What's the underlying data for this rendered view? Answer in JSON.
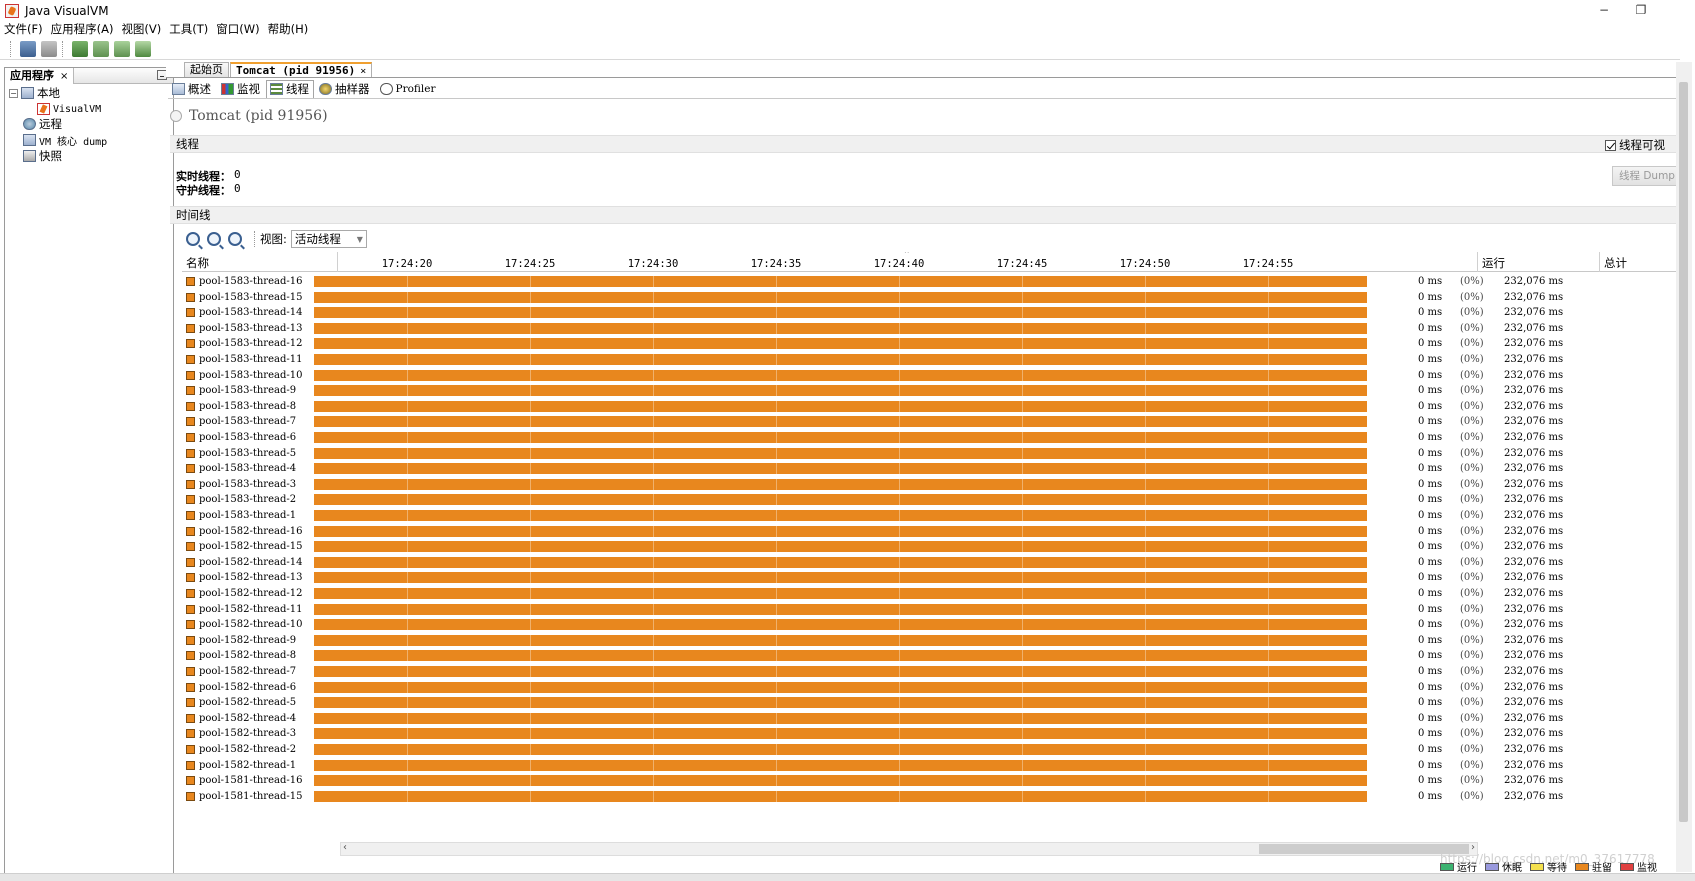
{
  "window": {
    "title": "Java VisualVM",
    "minimize_glyph": "−",
    "restore_glyph": "❐"
  },
  "menus": [
    "文件(F)",
    "应用程序(A)",
    "视图(V)",
    "工具(T)",
    "窗口(W)",
    "帮助(H)"
  ],
  "left_panel": {
    "tab_label": "应用程序",
    "close_glyph": "×",
    "tree": [
      {
        "label": "本地",
        "icon": "computer-icon",
        "expanded": true
      },
      {
        "label": "VisualVM",
        "icon": "visualvm-icon"
      },
      {
        "label": "远程",
        "icon": "remote-host-icon"
      },
      {
        "label": "VM 核心 dump",
        "icon": "core-dump-icon"
      },
      {
        "label": "快照",
        "icon": "snapshot-icon"
      }
    ]
  },
  "doc_tabs": [
    {
      "label": "起始页",
      "active": false
    },
    {
      "label": "Tomcat (pid 91956)",
      "active": true,
      "close_glyph": "×"
    }
  ],
  "sub_tabs": [
    {
      "label": "概述",
      "icon": "overview-icon"
    },
    {
      "label": "监视",
      "icon": "monitor-icon"
    },
    {
      "label": "线程",
      "icon": "threads-icon",
      "active": true
    },
    {
      "label": "抽样器",
      "icon": "sampler-icon"
    },
    {
      "label": "Profiler",
      "icon": "profiler-icon"
    }
  ],
  "process_title": "Tomcat (pid 91956)",
  "threads_section": {
    "header": "线程",
    "visible_checkbox_label": "线程可视",
    "visible_checked": true,
    "live_threads_label": "实时线程：",
    "live_threads_value": "0",
    "daemon_threads_label": "守护线程：",
    "daemon_threads_value": "0",
    "dump_button_label": "线程 Dump"
  },
  "timeline": {
    "header": "时间线",
    "view_label": "视图:",
    "view_selected": "活动线程",
    "columns": {
      "name": "名称",
      "running": "运行",
      "total": "总计"
    },
    "ticks": [
      "17:24:20",
      "17:24:25",
      "17:24:30",
      "17:24:35",
      "17:24:40",
      "17:24:45",
      "17:24:50",
      "17:24:55"
    ],
    "state_color": "#e8871e",
    "threads": [
      {
        "name": "pool-1583-thread-16",
        "running": "0 ms",
        "pct": "(0%)",
        "total": "232,076 ms"
      },
      {
        "name": "pool-1583-thread-15",
        "running": "0 ms",
        "pct": "(0%)",
        "total": "232,076 ms"
      },
      {
        "name": "pool-1583-thread-14",
        "running": "0 ms",
        "pct": "(0%)",
        "total": "232,076 ms"
      },
      {
        "name": "pool-1583-thread-13",
        "running": "0 ms",
        "pct": "(0%)",
        "total": "232,076 ms"
      },
      {
        "name": "pool-1583-thread-12",
        "running": "0 ms",
        "pct": "(0%)",
        "total": "232,076 ms"
      },
      {
        "name": "pool-1583-thread-11",
        "running": "0 ms",
        "pct": "(0%)",
        "total": "232,076 ms"
      },
      {
        "name": "pool-1583-thread-10",
        "running": "0 ms",
        "pct": "(0%)",
        "total": "232,076 ms"
      },
      {
        "name": "pool-1583-thread-9",
        "running": "0 ms",
        "pct": "(0%)",
        "total": "232,076 ms"
      },
      {
        "name": "pool-1583-thread-8",
        "running": "0 ms",
        "pct": "(0%)",
        "total": "232,076 ms"
      },
      {
        "name": "pool-1583-thread-7",
        "running": "0 ms",
        "pct": "(0%)",
        "total": "232,076 ms"
      },
      {
        "name": "pool-1583-thread-6",
        "running": "0 ms",
        "pct": "(0%)",
        "total": "232,076 ms"
      },
      {
        "name": "pool-1583-thread-5",
        "running": "0 ms",
        "pct": "(0%)",
        "total": "232,076 ms"
      },
      {
        "name": "pool-1583-thread-4",
        "running": "0 ms",
        "pct": "(0%)",
        "total": "232,076 ms"
      },
      {
        "name": "pool-1583-thread-3",
        "running": "0 ms",
        "pct": "(0%)",
        "total": "232,076 ms"
      },
      {
        "name": "pool-1583-thread-2",
        "running": "0 ms",
        "pct": "(0%)",
        "total": "232,076 ms"
      },
      {
        "name": "pool-1583-thread-1",
        "running": "0 ms",
        "pct": "(0%)",
        "total": "232,076 ms"
      },
      {
        "name": "pool-1582-thread-16",
        "running": "0 ms",
        "pct": "(0%)",
        "total": "232,076 ms"
      },
      {
        "name": "pool-1582-thread-15",
        "running": "0 ms",
        "pct": "(0%)",
        "total": "232,076 ms"
      },
      {
        "name": "pool-1582-thread-14",
        "running": "0 ms",
        "pct": "(0%)",
        "total": "232,076 ms"
      },
      {
        "name": "pool-1582-thread-13",
        "running": "0 ms",
        "pct": "(0%)",
        "total": "232,076 ms"
      },
      {
        "name": "pool-1582-thread-12",
        "running": "0 ms",
        "pct": "(0%)",
        "total": "232,076 ms"
      },
      {
        "name": "pool-1582-thread-11",
        "running": "0 ms",
        "pct": "(0%)",
        "total": "232,076 ms"
      },
      {
        "name": "pool-1582-thread-10",
        "running": "0 ms",
        "pct": "(0%)",
        "total": "232,076 ms"
      },
      {
        "name": "pool-1582-thread-9",
        "running": "0 ms",
        "pct": "(0%)",
        "total": "232,076 ms"
      },
      {
        "name": "pool-1582-thread-8",
        "running": "0 ms",
        "pct": "(0%)",
        "total": "232,076 ms"
      },
      {
        "name": "pool-1582-thread-7",
        "running": "0 ms",
        "pct": "(0%)",
        "total": "232,076 ms"
      },
      {
        "name": "pool-1582-thread-6",
        "running": "0 ms",
        "pct": "(0%)",
        "total": "232,076 ms"
      },
      {
        "name": "pool-1582-thread-5",
        "running": "0 ms",
        "pct": "(0%)",
        "total": "232,076 ms"
      },
      {
        "name": "pool-1582-thread-4",
        "running": "0 ms",
        "pct": "(0%)",
        "total": "232,076 ms"
      },
      {
        "name": "pool-1582-thread-3",
        "running": "0 ms",
        "pct": "(0%)",
        "total": "232,076 ms"
      },
      {
        "name": "pool-1582-thread-2",
        "running": "0 ms",
        "pct": "(0%)",
        "total": "232,076 ms"
      },
      {
        "name": "pool-1582-thread-1",
        "running": "0 ms",
        "pct": "(0%)",
        "total": "232,076 ms"
      },
      {
        "name": "pool-1581-thread-16",
        "running": "0 ms",
        "pct": "(0%)",
        "total": "232,076 ms"
      },
      {
        "name": "pool-1581-thread-15",
        "running": "0 ms",
        "pct": "(0%)",
        "total": "232,076 ms"
      }
    ],
    "legend": [
      {
        "label": "运行",
        "color": "#3cb371"
      },
      {
        "label": "休眠",
        "color": "#9999dd"
      },
      {
        "label": "等待",
        "color": "#f4e04d"
      },
      {
        "label": "驻留",
        "color": "#e8871e"
      },
      {
        "label": "监视",
        "color": "#e04040"
      }
    ]
  },
  "watermark": "https://blog.csdn.net/m0_37617778"
}
